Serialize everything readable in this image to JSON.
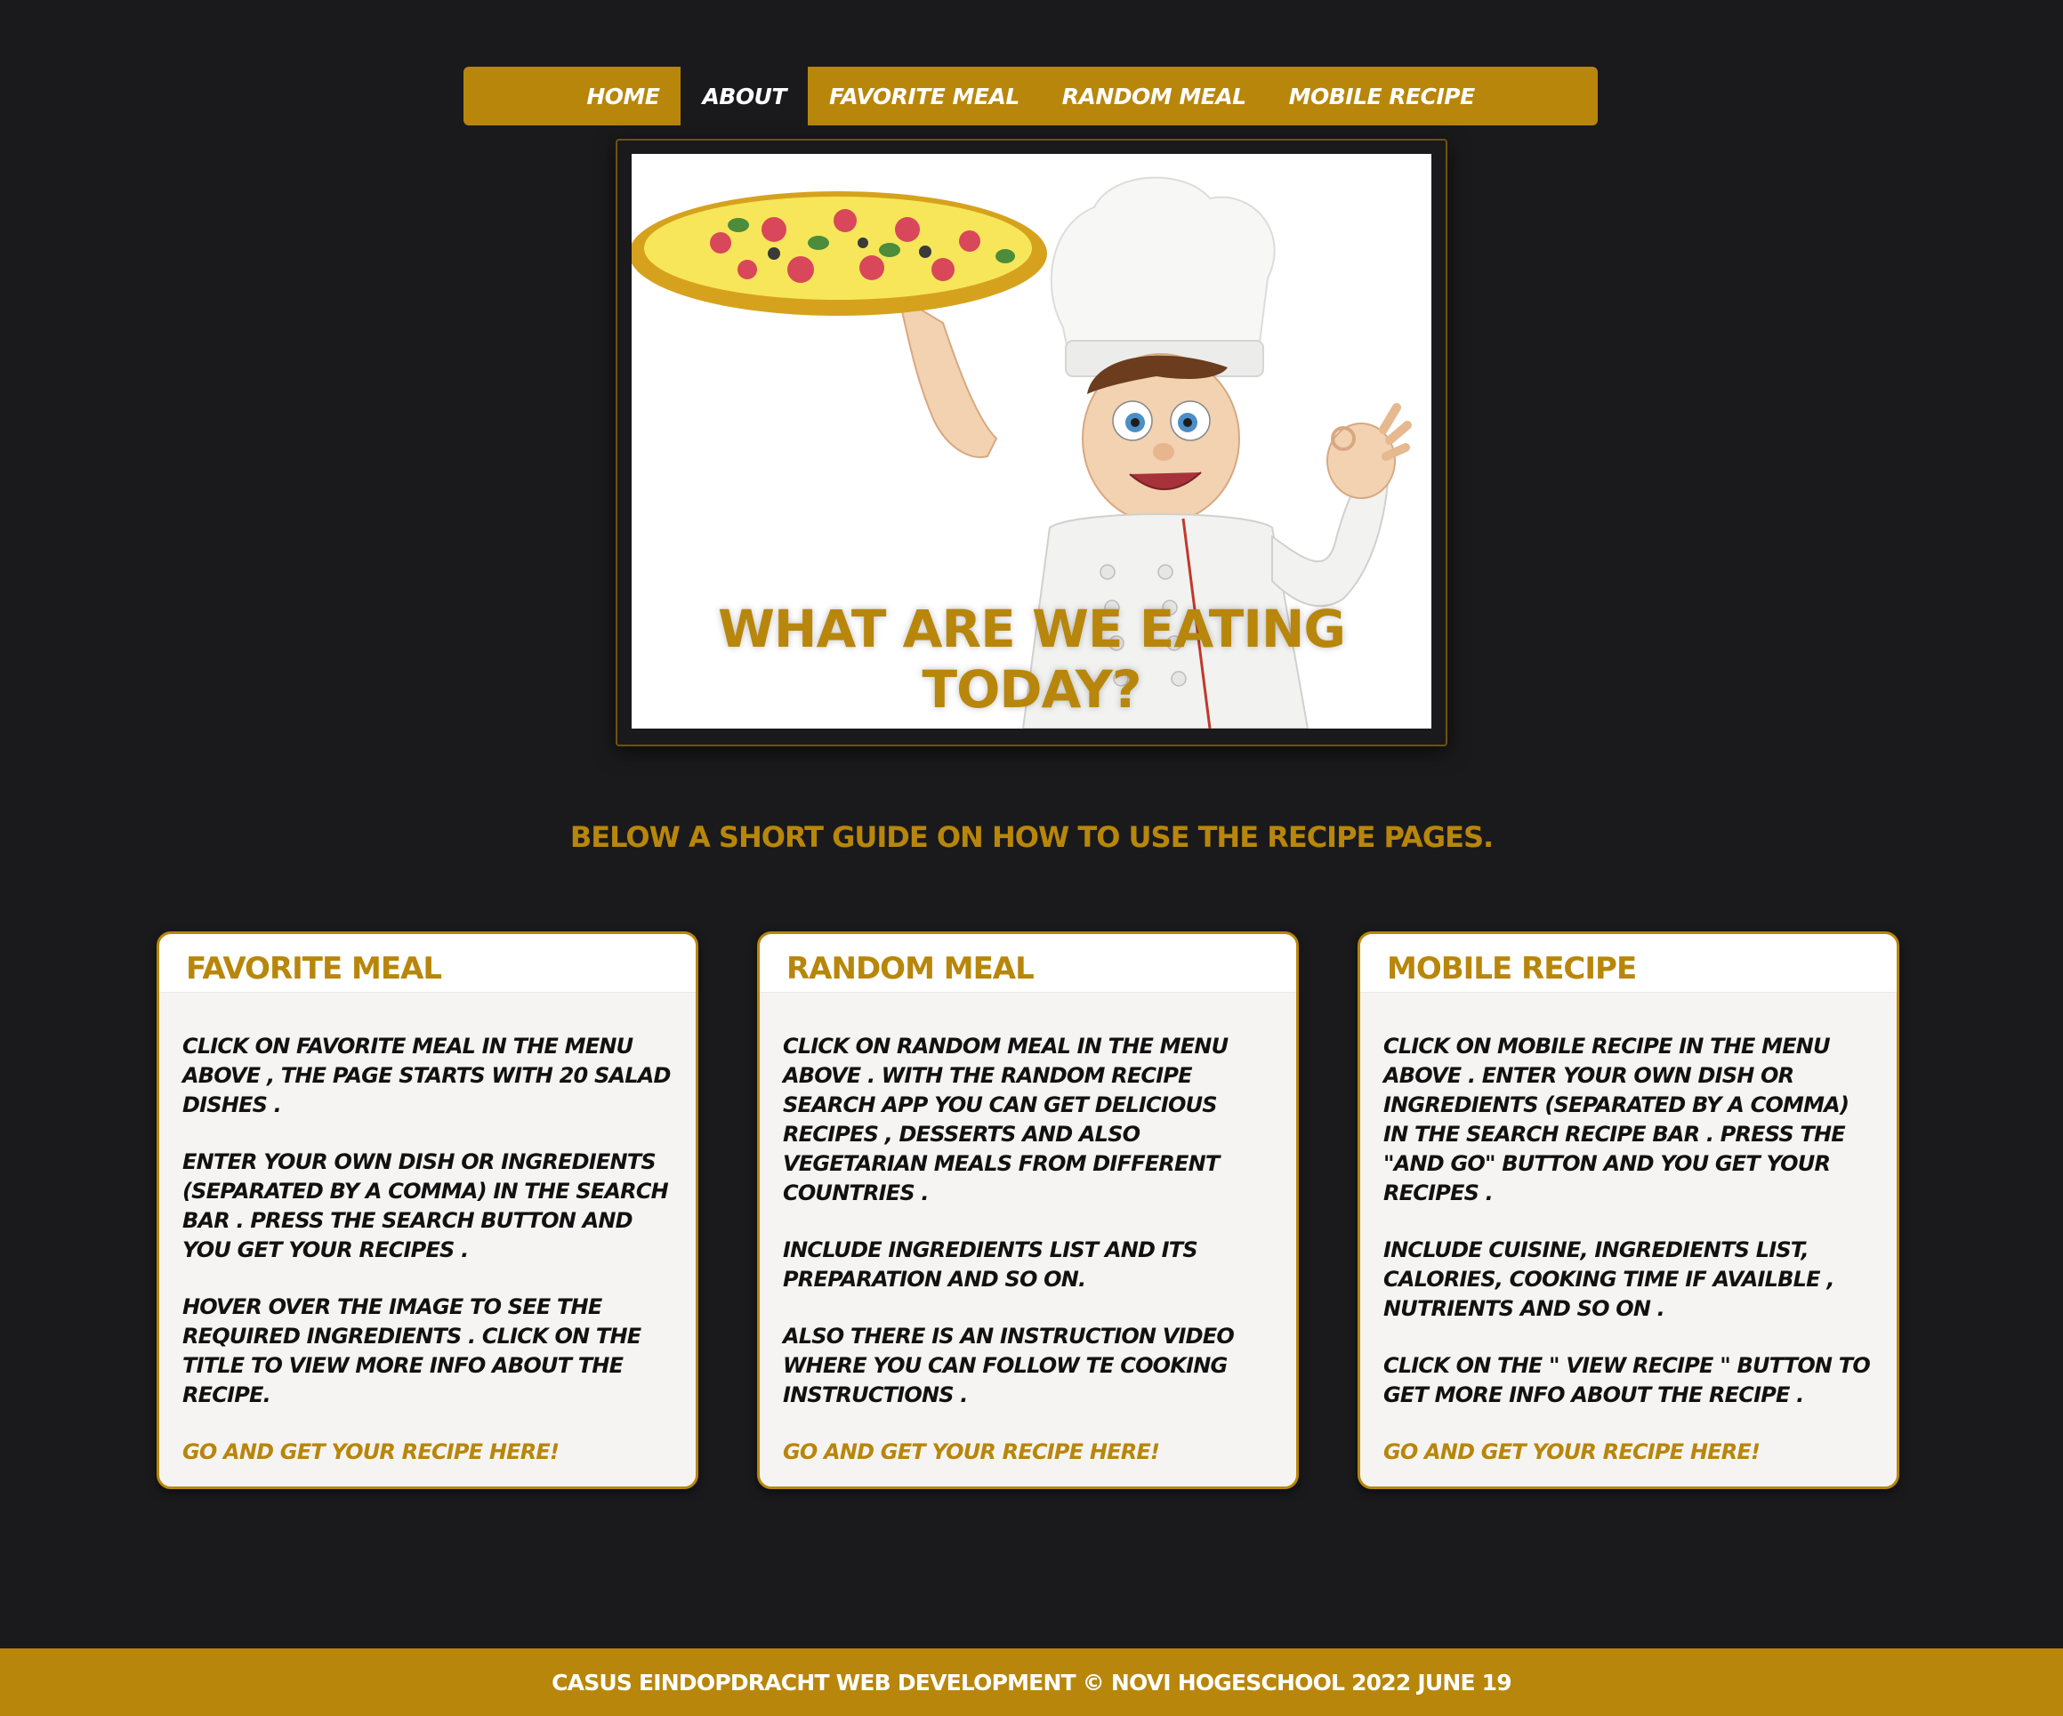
{
  "nav": {
    "items": [
      {
        "label": "HOME"
      },
      {
        "label": "ABOUT"
      },
      {
        "label": "FAVORITE MEAL"
      },
      {
        "label": "RANDOM MEAL"
      },
      {
        "label": "MOBILE RECIPE"
      }
    ],
    "active": "ABOUT"
  },
  "hero": {
    "caption": "WHAT ARE WE EATING TODAY?"
  },
  "guide": {
    "text": "BELOW A SHORT GUIDE ON HOW TO USE THE RECIPE PAGES."
  },
  "cards": [
    {
      "title": "FAVORITE MEAL",
      "paragraphs": [
        "CLICK ON FAVORITE MEAL IN THE MENU ABOVE , THE PAGE STARTS WITH 20 SALAD DISHES .",
        "ENTER YOUR OWN DISH OR INGREDIENTS (SEPARATED BY A COMMA) IN THE SEARCH BAR . PRESS THE SEARCH BUTTON AND YOU GET YOUR RECIPES .",
        "HOVER OVER THE IMAGE TO SEE THE REQUIRED INGREDIENTS . CLICK ON THE TITLE TO VIEW MORE INFO ABOUT THE RECIPE."
      ],
      "link": "GO AND GET YOUR RECIPE HERE!"
    },
    {
      "title": "RANDOM MEAL",
      "paragraphs": [
        "CLICK ON RANDOM MEAL IN THE MENU ABOVE . WITH THE RANDOM RECIPE SEARCH APP YOU CAN GET DELICIOUS RECIPES , DESSERTS AND ALSO VEGETARIAN MEALS FROM DIFFERENT COUNTRIES .",
        "INCLUDE INGREDIENTS LIST AND ITS PREPARATION AND SO ON.",
        "ALSO THERE IS AN INSTRUCTION VIDEO WHERE YOU CAN FOLLOW TE COOKING INSTRUCTIONS ."
      ],
      "link": "GO AND GET YOUR RECIPE HERE!"
    },
    {
      "title": "MOBILE RECIPE",
      "paragraphs": [
        "CLICK ON MOBILE RECIPE IN THE MENU ABOVE . ENTER YOUR OWN DISH OR INGREDIENTS (SEPARATED BY A COMMA) IN THE SEARCH RECIPE BAR . PRESS THE \"AND GO\" BUTTON AND YOU GET YOUR RECIPES .",
        "INCLUDE CUISINE, INGREDIENTS LIST, CALORIES, COOKING TIME IF AVAILBLE , NUTRIENTS AND SO ON .",
        "CLICK ON THE \" VIEW RECIPE \" BUTTON TO GET MORE INFO ABOUT THE RECIPE ."
      ],
      "link": "GO AND GET YOUR RECIPE HERE!"
    }
  ],
  "footer": {
    "text": "CASUS EINDOPDRACHT WEB DEVELOPMENT © NOVI HOGESCHOOL 2022 JUNE 19"
  },
  "colors": {
    "background": "#1a1a1c",
    "accent": "#b8860b",
    "card": "#f6f4f3"
  },
  "icons": {
    "hero": "chef-with-pizza-illustration"
  }
}
